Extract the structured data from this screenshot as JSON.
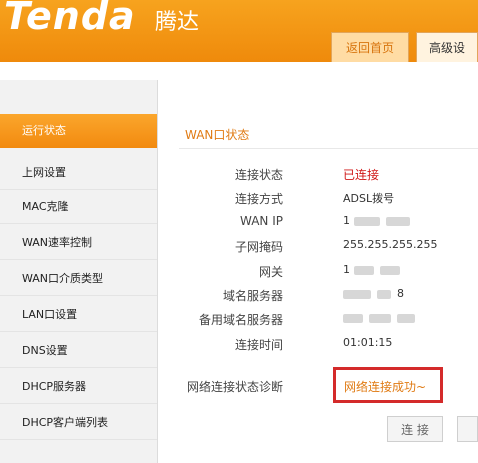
{
  "header": {
    "logo_text": "Tenda",
    "logo_cn": "腾达",
    "tab_home": "返回首页",
    "tab_advanced": "高级设"
  },
  "sidebar": {
    "items": [
      {
        "label": "运行状态",
        "active": true
      },
      {
        "label": "上网设置"
      },
      {
        "label": "MAC克隆"
      },
      {
        "label": "WAN速率控制"
      },
      {
        "label": "WAN口介质类型"
      },
      {
        "label": "LAN口设置"
      },
      {
        "label": "DNS设置"
      },
      {
        "label": "DHCP服务器"
      },
      {
        "label": "DHCP客户端列表"
      }
    ]
  },
  "wan_status": {
    "title": "WAN口状态",
    "rows": [
      {
        "label": "连接状态",
        "value": "已连接"
      },
      {
        "label": "连接方式",
        "value": "ADSL拨号"
      },
      {
        "label": "WAN IP",
        "value": "1"
      },
      {
        "label": "子网掩码",
        "value": "255.255.255.255"
      },
      {
        "label": "网关",
        "value": "1"
      },
      {
        "label": "域名服务器",
        "value": "8"
      },
      {
        "label": "备用域名服务器",
        "value": ""
      },
      {
        "label": "连接时间",
        "value": "01:01:15"
      }
    ],
    "diagnosis_label": "网络连接状态诊断",
    "diagnosis_value": "网络连接成功~",
    "connect_button": "连 接"
  },
  "colors": {
    "brand_orange": "#f39214",
    "status_red": "#d01818",
    "highlight_box": "#d42a2a"
  }
}
